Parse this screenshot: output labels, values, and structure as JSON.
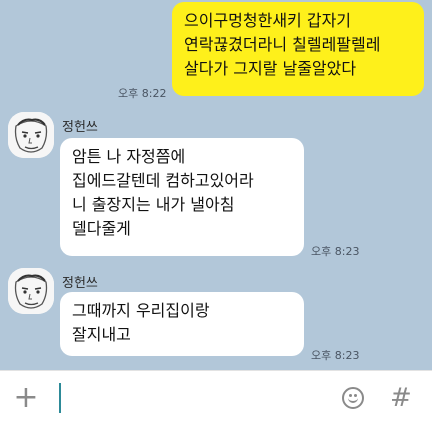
{
  "messages": [
    {
      "id": "m1",
      "from": "me",
      "text": "으이구멍청한새키 갑자기\n연락끊겼더라니 칠렐레팔렐레\n살다가 그지랄 날줄알았다",
      "time": "오후 8:22"
    },
    {
      "id": "m2",
      "from": "them",
      "sender": "정헌쓰",
      "text": "암튼 나 자정쯤에\n집에드갈텐데 컴하고있어라\n니 출장지는 내가 낼아침\n델다줄게",
      "time": "오후 8:23"
    },
    {
      "id": "m3",
      "from": "them",
      "sender": "정헌쓰",
      "text": "그때까지 우리집이랑\n잘지내고",
      "time": "오후 8:23"
    }
  ],
  "input_bar": {
    "plus_icon": "plus-icon",
    "emoji_icon": "emoji-icon",
    "hash_icon": "hash-icon",
    "plus_glyph": "+",
    "hash_glyph": "#"
  },
  "colors": {
    "background": "#b2c7d9",
    "my_bubble": "#fef01b",
    "their_bubble": "#ffffff"
  }
}
